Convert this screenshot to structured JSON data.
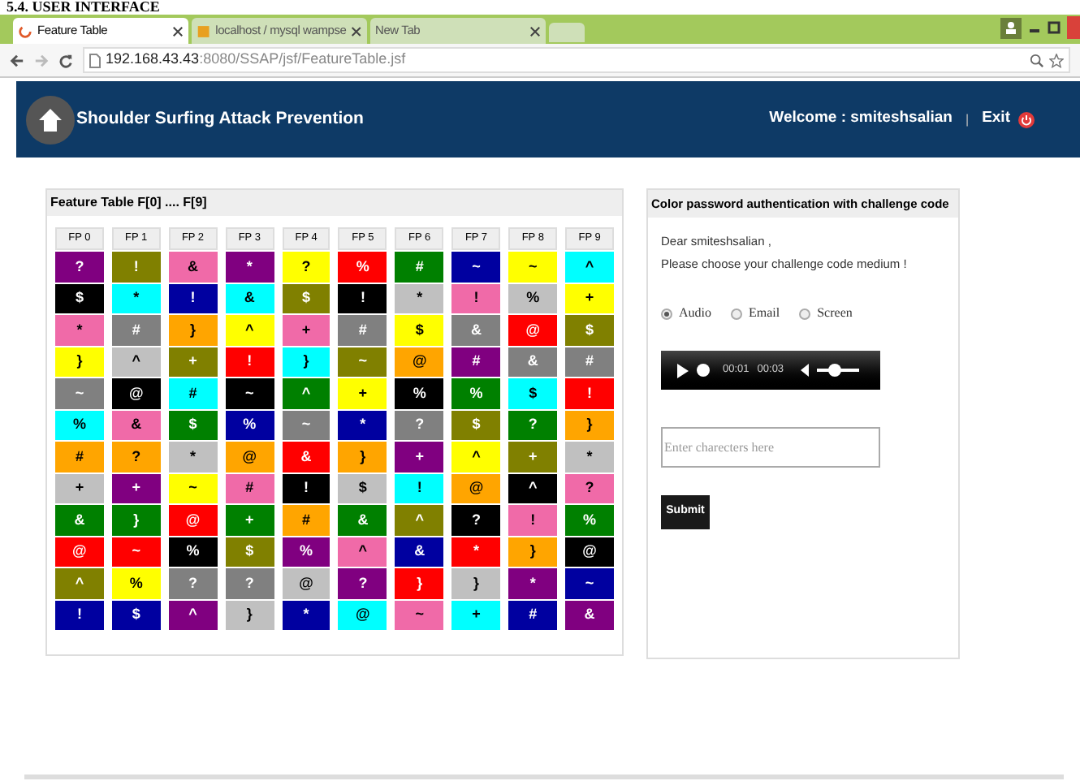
{
  "doc_heading": "5.4. USER INTERFACE",
  "browser": {
    "tabs": [
      {
        "label": "Feature Table",
        "selected": true
      },
      {
        "label": "localhost / mysql wampse",
        "selected": false
      },
      {
        "label": "New Tab",
        "selected": false
      }
    ],
    "address": {
      "host": "192.168.43.43",
      "path": ":8080/SSAP/jsf/FeatureTable.jsf"
    }
  },
  "header": {
    "title": "Shoulder Surfing Attack Prevention",
    "welcome": "Welcome : smiteshsalian",
    "separator": "|",
    "exit": "Exit"
  },
  "feature_table": {
    "title": "Feature Table F[0] .... F[9]",
    "columns": [
      {
        "header": "FP 0",
        "cells": [
          {
            "symbol": "?",
            "color": "#800080"
          },
          {
            "symbol": "$",
            "color": "#000000"
          },
          {
            "symbol": "*",
            "color": "#f06aa8"
          },
          {
            "symbol": "}",
            "color": "#ffff00"
          },
          {
            "symbol": "~",
            "color": "#808080"
          },
          {
            "symbol": "%",
            "color": "#00ffff"
          },
          {
            "symbol": "#",
            "color": "#ffa500"
          },
          {
            "symbol": "+",
            "color": "#c0c0c0"
          },
          {
            "symbol": "&",
            "color": "#008000"
          },
          {
            "symbol": "@",
            "color": "#ff0000"
          },
          {
            "symbol": "^",
            "color": "#808000"
          },
          {
            "symbol": "!",
            "color": "#0000a0"
          }
        ]
      },
      {
        "header": "FP 1",
        "cells": [
          {
            "symbol": "!",
            "color": "#808000"
          },
          {
            "symbol": "*",
            "color": "#00ffff"
          },
          {
            "symbol": "#",
            "color": "#808080"
          },
          {
            "symbol": "^",
            "color": "#c0c0c0"
          },
          {
            "symbol": "@",
            "color": "#000000"
          },
          {
            "symbol": "&",
            "color": "#f06aa8"
          },
          {
            "symbol": "?",
            "color": "#ffa500"
          },
          {
            "symbol": "+",
            "color": "#800080"
          },
          {
            "symbol": "}",
            "color": "#008000"
          },
          {
            "symbol": "~",
            "color": "#ff0000"
          },
          {
            "symbol": "%",
            "color": "#ffff00"
          },
          {
            "symbol": "$",
            "color": "#0000a0"
          }
        ]
      },
      {
        "header": "FP 2",
        "cells": [
          {
            "symbol": "&",
            "color": "#f06aa8"
          },
          {
            "symbol": "!",
            "color": "#0000a0"
          },
          {
            "symbol": "}",
            "color": "#ffa500"
          },
          {
            "symbol": "+",
            "color": "#808000"
          },
          {
            "symbol": "#",
            "color": "#00ffff"
          },
          {
            "symbol": "$",
            "color": "#008000"
          },
          {
            "symbol": "*",
            "color": "#c0c0c0"
          },
          {
            "symbol": "~",
            "color": "#ffff00"
          },
          {
            "symbol": "@",
            "color": "#ff0000"
          },
          {
            "symbol": "%",
            "color": "#000000"
          },
          {
            "symbol": "?",
            "color": "#808080"
          },
          {
            "symbol": "^",
            "color": "#800080"
          }
        ]
      },
      {
        "header": "FP 3",
        "cells": [
          {
            "symbol": "*",
            "color": "#800080"
          },
          {
            "symbol": "&",
            "color": "#00ffff"
          },
          {
            "symbol": "^",
            "color": "#ffff00"
          },
          {
            "symbol": "!",
            "color": "#ff0000"
          },
          {
            "symbol": "~",
            "color": "#000000"
          },
          {
            "symbol": "%",
            "color": "#0000a0"
          },
          {
            "symbol": "@",
            "color": "#ffa500"
          },
          {
            "symbol": "#",
            "color": "#f06aa8"
          },
          {
            "symbol": "+",
            "color": "#008000"
          },
          {
            "symbol": "$",
            "color": "#808000"
          },
          {
            "symbol": "?",
            "color": "#808080"
          },
          {
            "symbol": "}",
            "color": "#c0c0c0"
          }
        ]
      },
      {
        "header": "FP 4",
        "cells": [
          {
            "symbol": "?",
            "color": "#ffff00"
          },
          {
            "symbol": "$",
            "color": "#808000"
          },
          {
            "symbol": "+",
            "color": "#f06aa8"
          },
          {
            "symbol": "}",
            "color": "#00ffff"
          },
          {
            "symbol": "^",
            "color": "#008000"
          },
          {
            "symbol": "~",
            "color": "#808080"
          },
          {
            "symbol": "&",
            "color": "#ff0000"
          },
          {
            "symbol": "!",
            "color": "#000000"
          },
          {
            "symbol": "#",
            "color": "#ffa500"
          },
          {
            "symbol": "%",
            "color": "#800080"
          },
          {
            "symbol": "@",
            "color": "#c0c0c0"
          },
          {
            "symbol": "*",
            "color": "#0000a0"
          }
        ]
      },
      {
        "header": "FP 5",
        "cells": [
          {
            "symbol": "%",
            "color": "#ff0000"
          },
          {
            "symbol": "!",
            "color": "#000000"
          },
          {
            "symbol": "#",
            "color": "#808080"
          },
          {
            "symbol": "~",
            "color": "#808000"
          },
          {
            "symbol": "+",
            "color": "#ffff00"
          },
          {
            "symbol": "*",
            "color": "#0000a0"
          },
          {
            "symbol": "}",
            "color": "#ffa500"
          },
          {
            "symbol": "$",
            "color": "#c0c0c0"
          },
          {
            "symbol": "&",
            "color": "#008000"
          },
          {
            "symbol": "^",
            "color": "#f06aa8"
          },
          {
            "symbol": "?",
            "color": "#800080"
          },
          {
            "symbol": "@",
            "color": "#00ffff"
          }
        ]
      },
      {
        "header": "FP 6",
        "cells": [
          {
            "symbol": "#",
            "color": "#008000"
          },
          {
            "symbol": "*",
            "color": "#c0c0c0"
          },
          {
            "symbol": "$",
            "color": "#ffff00"
          },
          {
            "symbol": "@",
            "color": "#ffa500"
          },
          {
            "symbol": "%",
            "color": "#000000"
          },
          {
            "symbol": "?",
            "color": "#808080"
          },
          {
            "symbol": "+",
            "color": "#800080"
          },
          {
            "symbol": "!",
            "color": "#00ffff"
          },
          {
            "symbol": "^",
            "color": "#808000"
          },
          {
            "symbol": "&",
            "color": "#0000a0"
          },
          {
            "symbol": "}",
            "color": "#ff0000"
          },
          {
            "symbol": "~",
            "color": "#f06aa8"
          }
        ]
      },
      {
        "header": "FP 7",
        "cells": [
          {
            "symbol": "~",
            "color": "#0000a0"
          },
          {
            "symbol": "!",
            "color": "#f06aa8"
          },
          {
            "symbol": "&",
            "color": "#808080"
          },
          {
            "symbol": "#",
            "color": "#800080"
          },
          {
            "symbol": "%",
            "color": "#008000"
          },
          {
            "symbol": "$",
            "color": "#808000"
          },
          {
            "symbol": "^",
            "color": "#ffff00"
          },
          {
            "symbol": "@",
            "color": "#ffa500"
          },
          {
            "symbol": "?",
            "color": "#000000"
          },
          {
            "symbol": "*",
            "color": "#ff0000"
          },
          {
            "symbol": "}",
            "color": "#c0c0c0"
          },
          {
            "symbol": "+",
            "color": "#00ffff"
          }
        ]
      },
      {
        "header": "FP 8",
        "cells": [
          {
            "symbol": "~",
            "color": "#ffff00"
          },
          {
            "symbol": "%",
            "color": "#c0c0c0"
          },
          {
            "symbol": "@",
            "color": "#ff0000"
          },
          {
            "symbol": "&",
            "color": "#808080"
          },
          {
            "symbol": "$",
            "color": "#00ffff"
          },
          {
            "symbol": "?",
            "color": "#008000"
          },
          {
            "symbol": "+",
            "color": "#808000"
          },
          {
            "symbol": "^",
            "color": "#000000"
          },
          {
            "symbol": "!",
            "color": "#f06aa8"
          },
          {
            "symbol": "}",
            "color": "#ffa500"
          },
          {
            "symbol": "*",
            "color": "#800080"
          },
          {
            "symbol": "#",
            "color": "#0000a0"
          }
        ]
      },
      {
        "header": "FP 9",
        "cells": [
          {
            "symbol": "^",
            "color": "#00ffff"
          },
          {
            "symbol": "+",
            "color": "#ffff00"
          },
          {
            "symbol": "$",
            "color": "#808000"
          },
          {
            "symbol": "#",
            "color": "#808080"
          },
          {
            "symbol": "!",
            "color": "#ff0000"
          },
          {
            "symbol": "}",
            "color": "#ffa500"
          },
          {
            "symbol": "*",
            "color": "#c0c0c0"
          },
          {
            "symbol": "?",
            "color": "#f06aa8"
          },
          {
            "symbol": "%",
            "color": "#008000"
          },
          {
            "symbol": "@",
            "color": "#000000"
          },
          {
            "symbol": "~",
            "color": "#0000a0"
          },
          {
            "symbol": "&",
            "color": "#800080"
          }
        ]
      }
    ]
  },
  "auth_panel": {
    "title": "Color password authentication with challenge code",
    "greeting": "Dear smiteshsalian ,",
    "prompt": "Please choose your challenge code medium !",
    "mediums": [
      {
        "label": "Audio",
        "selected": true
      },
      {
        "label": "Email",
        "selected": false
      },
      {
        "label": "Screen",
        "selected": false
      }
    ],
    "player": {
      "elapsed": "00:01",
      "duration": "00:03",
      "level": 0.45
    },
    "code_field": {
      "placeholder": "Enter charecters here"
    },
    "submit": "Submit"
  }
}
